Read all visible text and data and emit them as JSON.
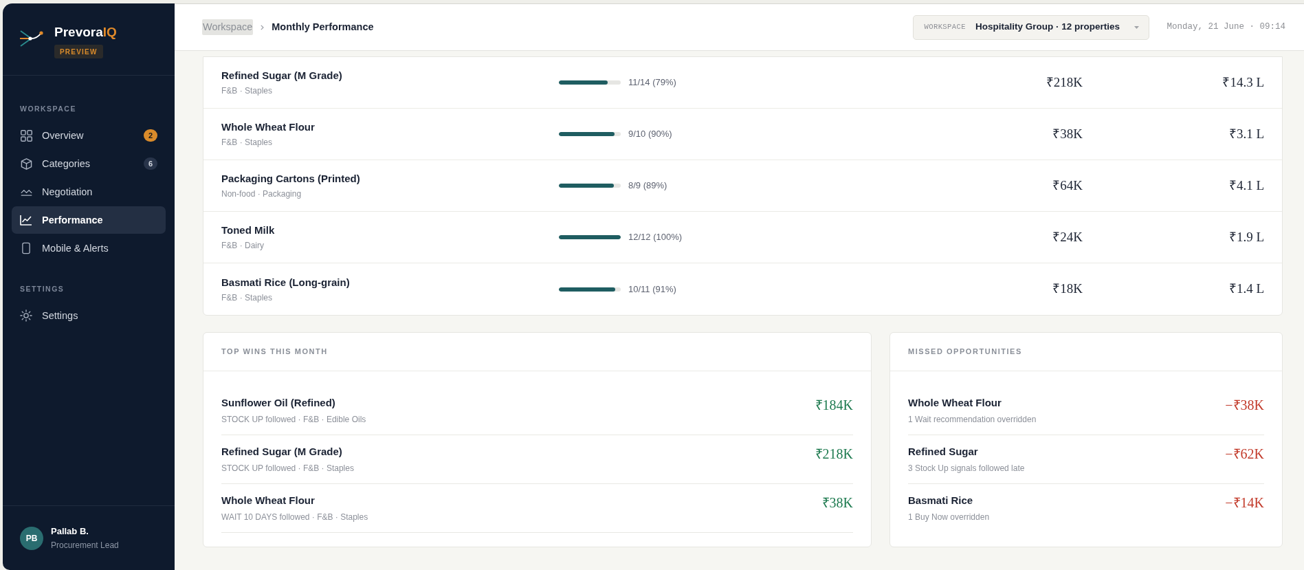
{
  "sidebar": {
    "brand": {
      "name": "Prevora",
      "accent": "IQ",
      "badge": "PREVIEW"
    },
    "sections": [
      {
        "title": "WORKSPACE",
        "items": [
          {
            "label": "Overview",
            "selected": false,
            "badge": {
              "text": "2",
              "kind": "alert"
            }
          },
          {
            "label": "Categories",
            "selected": false,
            "badge": {
              "text": "6",
              "kind": "count"
            }
          },
          {
            "label": "Negotiation",
            "selected": false
          },
          {
            "label": "Performance",
            "selected": true
          },
          {
            "label": "Mobile & Alerts",
            "selected": false
          }
        ]
      },
      {
        "title": "SETTINGS",
        "items": [
          {
            "label": "Settings",
            "selected": false
          }
        ]
      }
    ],
    "user": {
      "initials": "PB",
      "name": "Pallab B.",
      "role": "Procurement Lead"
    }
  },
  "header": {
    "breadcrumb": [
      {
        "label": "Workspace",
        "current": false
      },
      {
        "label": "Monthly Performance",
        "current": true
      }
    ],
    "workspace_picker": {
      "label": "WORKSPACE",
      "value": "Hospitality Group · 12 properties"
    },
    "datetime": "Monday, 21 June · 09:14"
  },
  "table": {
    "rows": [
      {
        "name": "Refined Sugar (M Grade)",
        "meta": "F&B · Staples",
        "level": 0.786,
        "reading": "11/14 (79%)",
        "column_3": "₹218K",
        "column_4": "₹14.3 L"
      },
      {
        "name": "Whole Wheat Flour",
        "meta": "F&B · Staples",
        "level": 0.9,
        "reading": "9/10 (90%)",
        "column_3": "₹38K",
        "column_4": "₹3.1 L"
      },
      {
        "name": "Packaging Cartons (Printed)",
        "meta": "Non-food · Packaging",
        "level": 0.889,
        "reading": "8/9 (89%)",
        "column_3": "₹64K",
        "column_4": "₹4.1 L"
      },
      {
        "name": "Toned Milk",
        "meta": "F&B · Dairy",
        "level": 1,
        "reading": "12/12 (100%)",
        "column_3": "₹24K",
        "column_4": "₹1.9 L"
      },
      {
        "name": "Basmati Rice (Long-grain)",
        "meta": "F&B · Staples",
        "level": 0.909,
        "reading": "10/11 (91%)",
        "column_3": "₹18K",
        "column_4": "₹1.4 L"
      }
    ]
  },
  "panels": [
    {
      "kind": "wins",
      "title": "TOP WINS THIS MONTH",
      "items": [
        {
          "name": "Sunflower Oil (Refined)",
          "detail": "STOCK UP followed · F&B · Edible Oils",
          "amount": "₹184K"
        },
        {
          "name": "Refined Sugar (M Grade)",
          "detail": "STOCK UP followed · F&B · Staples",
          "amount": "₹218K"
        },
        {
          "name": "Whole Wheat Flour",
          "detail": "WAIT 10 DAYS followed · F&B · Staples",
          "amount": "₹38K"
        }
      ]
    },
    {
      "kind": "missed",
      "title": "MISSED OPPORTUNITIES",
      "items": [
        {
          "name": "Whole Wheat Flour",
          "detail": "1 Wait recommendation overridden",
          "amount": "−₹38K"
        },
        {
          "name": "Refined Sugar",
          "detail": "3 Stock Up signals followed late",
          "amount": "−₹62K"
        },
        {
          "name": "Basmati Rice",
          "detail": "1 Buy Now overridden",
          "amount": "−₹14K"
        }
      ]
    }
  ]
}
